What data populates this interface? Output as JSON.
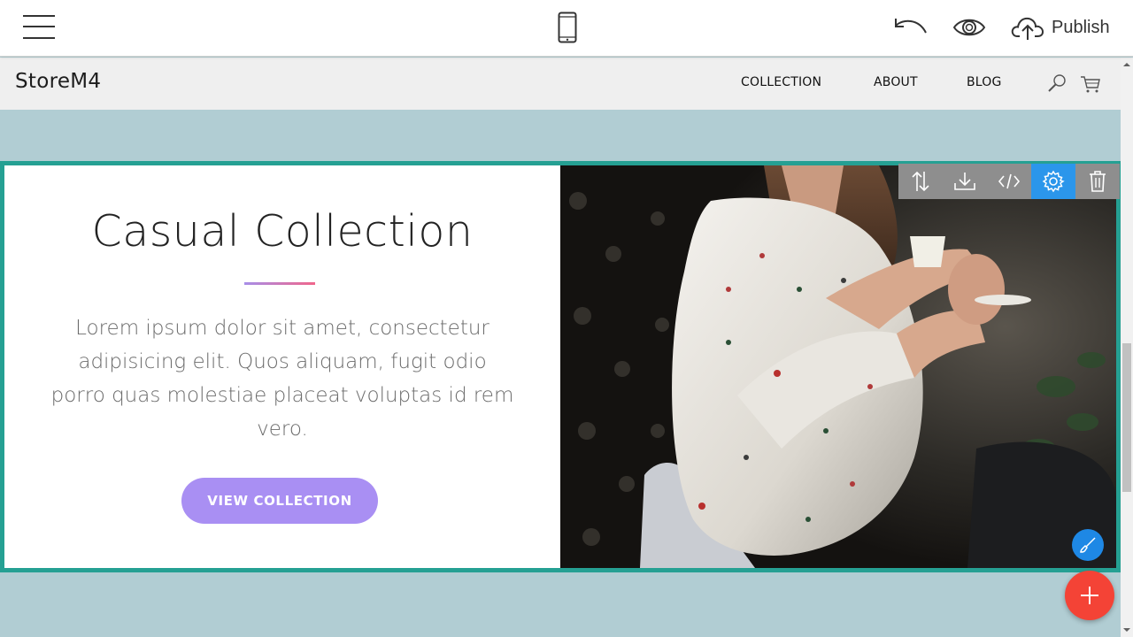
{
  "toolbar": {
    "menu_icon": "hamburger-icon",
    "device_icon": "mobile-phone-icon",
    "undo_icon": "undo-icon",
    "preview_icon": "eye-icon",
    "publish_icon": "cloud-upload-icon",
    "publish_label": "Publish"
  },
  "site_nav": {
    "brand": "StoreM4",
    "links": [
      {
        "label": "COLLECTION"
      },
      {
        "label": "ABOUT"
      },
      {
        "label": "BLOG"
      }
    ],
    "search_icon": "search-icon",
    "cart_icon": "shopping-cart-icon"
  },
  "block": {
    "title": "Casual Collection",
    "description": "Lorem ipsum dolor sit amet, consectetur adipisicing elit. Quos aliquam, fugit odio porro quas molestiae placeat voluptas id rem vero.",
    "button_label": "VIEW COLLECTION",
    "image": "woman-in-white-blouse-holding-cup-photo",
    "tools": [
      {
        "icon": "reorder-arrows-icon"
      },
      {
        "icon": "download-icon"
      },
      {
        "icon": "code-icon"
      },
      {
        "icon": "gear-icon",
        "active": true
      },
      {
        "icon": "trash-icon"
      }
    ],
    "accent_color": "#25a093",
    "button_color": "#a98ff3"
  },
  "floating": {
    "brush_icon": "paintbrush-icon",
    "add_icon": "plus-icon",
    "add_color": "#f44336"
  }
}
